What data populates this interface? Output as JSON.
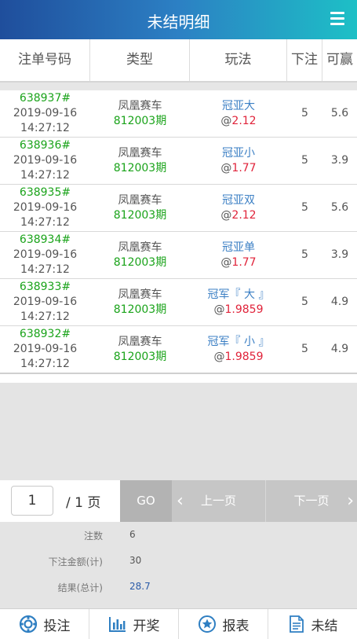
{
  "header": {
    "title": "未结明细"
  },
  "columns": [
    "注单号码",
    "类型",
    "玩法",
    "下注",
    "可赢"
  ],
  "rows": [
    {
      "no": "638937#",
      "date": "2019-09-16",
      "time": "14:27:12",
      "game": "凤凰赛车",
      "period": "812003期",
      "play": "冠亚大",
      "at": "@",
      "odds": "2.12",
      "bet": "5",
      "win": "5.6"
    },
    {
      "no": "638936#",
      "date": "2019-09-16",
      "time": "14:27:12",
      "game": "凤凰赛车",
      "period": "812003期",
      "play": "冠亚小",
      "at": "@",
      "odds": "1.77",
      "bet": "5",
      "win": "3.9"
    },
    {
      "no": "638935#",
      "date": "2019-09-16",
      "time": "14:27:12",
      "game": "凤凰赛车",
      "period": "812003期",
      "play": "冠亚双",
      "at": "@",
      "odds": "2.12",
      "bet": "5",
      "win": "5.6"
    },
    {
      "no": "638934#",
      "date": "2019-09-16",
      "time": "14:27:12",
      "game": "凤凰赛车",
      "period": "812003期",
      "play": "冠亚单",
      "at": "@",
      "odds": "1.77",
      "bet": "5",
      "win": "3.9"
    },
    {
      "no": "638933#",
      "date": "2019-09-16",
      "time": "14:27:12",
      "game": "凤凰赛车",
      "period": "812003期",
      "play": "冠军『 大 』",
      "at": "@",
      "odds": "1.9859",
      "bet": "5",
      "win": "4.9"
    },
    {
      "no": "638932#",
      "date": "2019-09-16",
      "time": "14:27:12",
      "game": "凤凰赛车",
      "period": "812003期",
      "play": "冠军『 小 』",
      "at": "@",
      "odds": "1.9859",
      "bet": "5",
      "win": "4.9"
    }
  ],
  "pager": {
    "page": "1",
    "total": "/ 1 页",
    "go": "GO",
    "prev": "上一页",
    "next": "下一页"
  },
  "summary": {
    "count_label": "注数",
    "count": "6",
    "amount_label": "下注金额(计)",
    "amount": "30",
    "result_label": "结果(总计)",
    "result": "28.7"
  },
  "tabs": [
    {
      "label": "投注",
      "icon": "lifebuoy-icon"
    },
    {
      "label": "开奖",
      "icon": "bar-chart-icon"
    },
    {
      "label": "报表",
      "icon": "star-circle-icon"
    },
    {
      "label": "未结",
      "icon": "document-icon"
    }
  ],
  "colors": {
    "accent_start": "#1f4e9c",
    "accent_end": "#1dc0c6",
    "green": "#1aa31a",
    "blue": "#3b7fc4",
    "red": "#e0233a"
  }
}
